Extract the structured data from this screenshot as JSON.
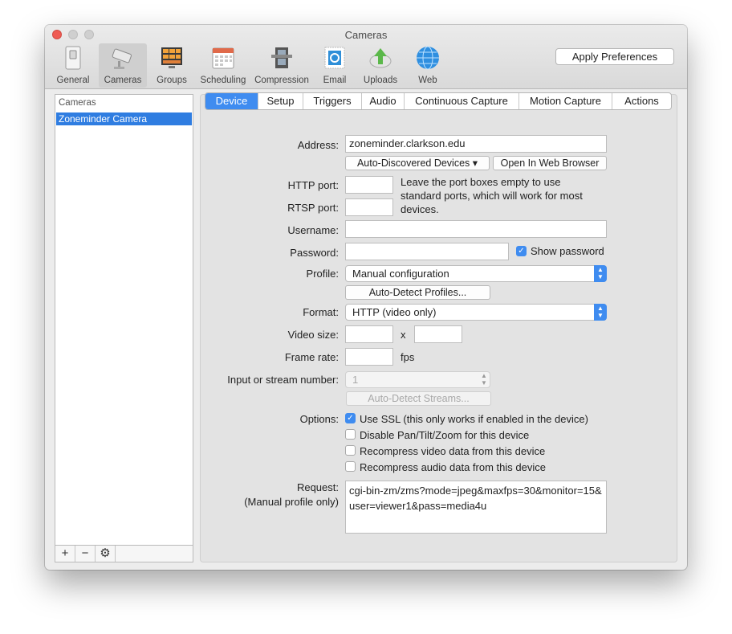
{
  "window": {
    "title": "Cameras"
  },
  "toolbar": {
    "items": [
      {
        "label": "General"
      },
      {
        "label": "Cameras"
      },
      {
        "label": "Groups"
      },
      {
        "label": "Scheduling"
      },
      {
        "label": "Compression"
      },
      {
        "label": "Email"
      },
      {
        "label": "Uploads"
      },
      {
        "label": "Web"
      }
    ],
    "apply_label": "Apply Preferences"
  },
  "sidebar": {
    "header": "Cameras",
    "items": [
      "Zoneminder Camera"
    ],
    "buttons": [
      "+",
      "−",
      "⚙"
    ]
  },
  "tabs": [
    "Device",
    "Setup",
    "Triggers",
    "Audio",
    "Continuous Capture",
    "Motion Capture",
    "Actions"
  ],
  "form": {
    "address_label": "Address:",
    "address_value": "zoneminder.clarkson.edu",
    "auto_discovered_label": "Auto-Discovered Devices ▾",
    "open_browser_label": "Open In Web Browser",
    "http_port_label": "HTTP port:",
    "http_port_value": "",
    "rtsp_port_label": "RTSP port:",
    "rtsp_port_value": "",
    "port_note": "Leave the port boxes empty to use standard ports, which will work for most devices.",
    "username_label": "Username:",
    "username_value": "",
    "password_label": "Password:",
    "password_value": "",
    "show_password_label": "Show password",
    "profile_label": "Profile:",
    "profile_value": "Manual configuration",
    "auto_detect_profiles_label": "Auto-Detect Profiles...",
    "format_label": "Format:",
    "format_value": "HTTP (video only)",
    "video_size_label": "Video size:",
    "video_size_x": "x",
    "frame_rate_label": "Frame rate:",
    "fps_label": "fps",
    "stream_label": "Input or stream number:",
    "stream_value": "1",
    "auto_detect_streams_label": "Auto-Detect Streams...",
    "options_label": "Options:",
    "options": [
      {
        "label": "Use SSL (this only works if enabled in the device)",
        "checked": true
      },
      {
        "label": "Disable Pan/Tilt/Zoom for this device",
        "checked": false
      },
      {
        "label": "Recompress video data from this device",
        "checked": false
      },
      {
        "label": "Recompress audio data from this device",
        "checked": false
      }
    ],
    "request_label": "Request:",
    "request_sublabel": "(Manual profile only)",
    "request_value": "cgi-bin-zm/zms?mode=jpeg&maxfps=30&monitor=15&user=viewer1&pass=media4u"
  }
}
